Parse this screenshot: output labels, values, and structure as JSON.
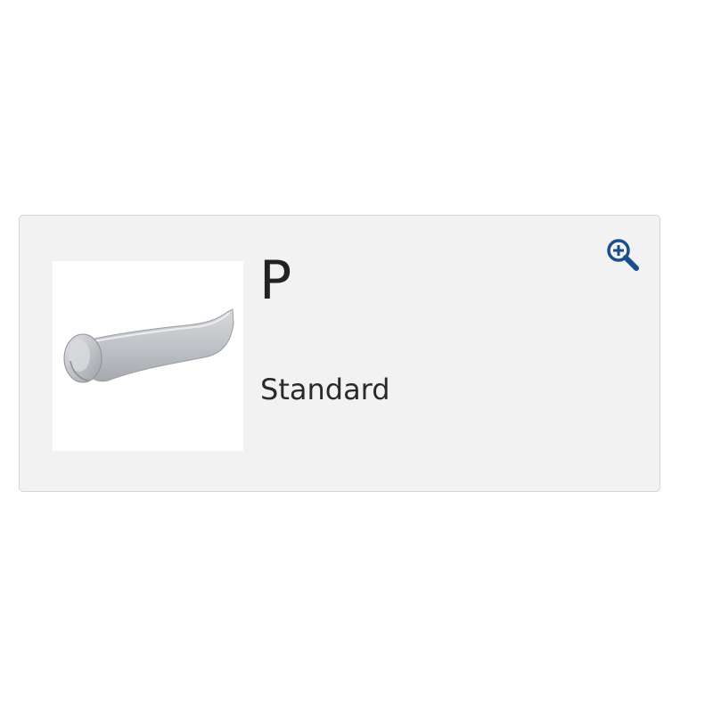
{
  "product": {
    "code": "P",
    "description": "Standard",
    "image_icon": "lever-handle-image",
    "zoom_icon": "zoom-in-icon"
  },
  "colors": {
    "card_background": "#f2f2f2",
    "card_border": "#d4d4d4",
    "accent": "#1a4f8b",
    "text": "#222222"
  }
}
